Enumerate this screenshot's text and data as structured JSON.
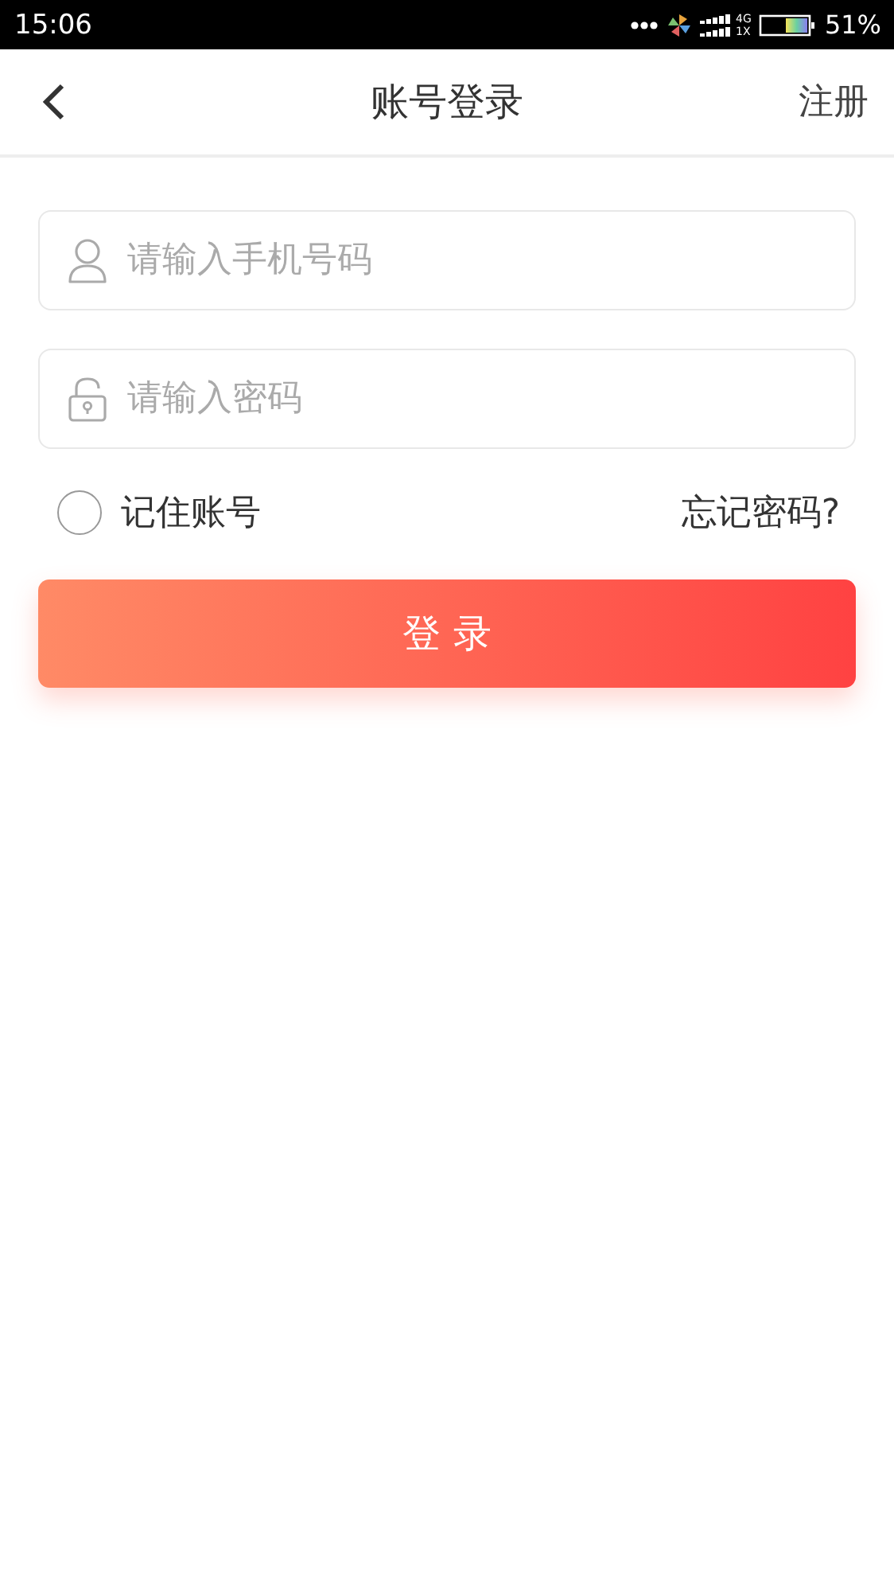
{
  "status_bar": {
    "time": "15:06",
    "network_top": "4G",
    "network_bottom": "1X",
    "battery": "51%"
  },
  "nav": {
    "title": "账号登录",
    "action": "注册"
  },
  "phone_field": {
    "placeholder": "请输入手机号码"
  },
  "password_field": {
    "placeholder": "请输入密码"
  },
  "remember": {
    "label": "记住账号",
    "checked": false
  },
  "forgot_link": "忘记密码?",
  "login_button": "登 录"
}
